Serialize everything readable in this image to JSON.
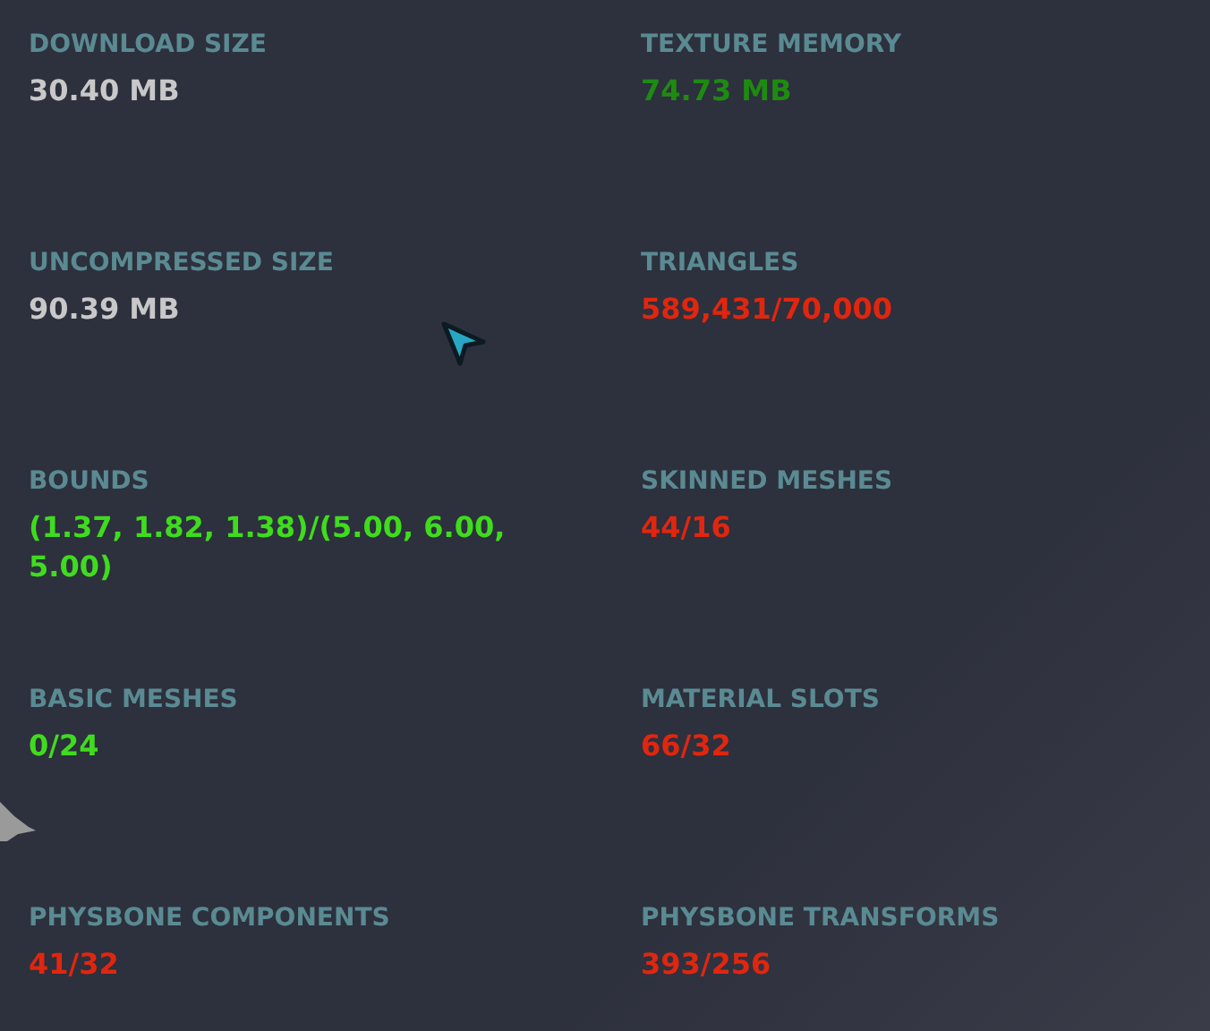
{
  "stats": [
    {
      "label": "DOWNLOAD SIZE",
      "value": "30.40 MB",
      "color": "#c8c8c8"
    },
    {
      "label": "TEXTURE MEMORY",
      "value": "74.73 MB",
      "color": "#1f8a12"
    },
    {
      "label": "UNCOMPRESSED SIZE",
      "value": "90.39 MB",
      "color": "#c8c8c8"
    },
    {
      "label": "TRIANGLES",
      "value": "589,431/70,000",
      "color": "#e0260f"
    },
    {
      "label": "BOUNDS",
      "value": "(1.37, 1.82, 1.38)/(5.00, 6.00, 5.00)",
      "color": "#3fdc1e"
    },
    {
      "label": "SKINNED MESHES",
      "value": "44/16",
      "color": "#e0260f"
    },
    {
      "label": "BASIC MESHES",
      "value": "0/24",
      "color": "#3fdc1e"
    },
    {
      "label": "MATERIAL SLOTS",
      "value": "66/32",
      "color": "#e0260f"
    },
    {
      "label": "PHYSBONE COMPONENTS",
      "value": "41/32",
      "color": "#e0260f"
    },
    {
      "label": "PHYSBONE TRANSFORMS",
      "value": "393/256",
      "color": "#e0260f"
    }
  ]
}
